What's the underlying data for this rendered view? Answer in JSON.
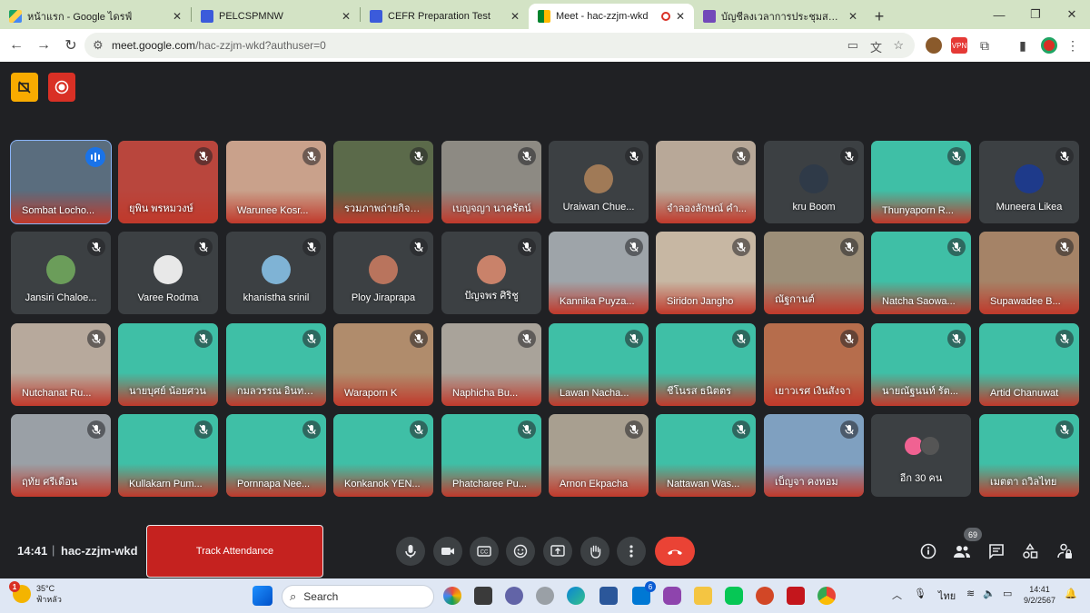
{
  "browser": {
    "tabs": [
      {
        "title": "หน้าแรก - Google ไดรฟ์",
        "active": false
      },
      {
        "title": "PELCSPMNW",
        "active": false
      },
      {
        "title": "CEFR Preparation Test",
        "active": false
      },
      {
        "title": "Meet - hac-zzjm-wkd",
        "active": true
      },
      {
        "title": "บัญชีลงเวลาการประชุมสอบ CEFR ปี",
        "active": false
      }
    ],
    "address_host": "meet.google.com",
    "address_path": "/hac-zzjm-wkd?authuser=0"
  },
  "participants": [
    {
      "name": "Sombat Locho...",
      "kind": "video",
      "speaking": true,
      "bg": "#5a6d7e"
    },
    {
      "name": "ยุพิน พรหมวงษ์",
      "kind": "video",
      "bg": "#b9463d"
    },
    {
      "name": "Warunee Kosr...",
      "kind": "video",
      "bg": "#c9a18b"
    },
    {
      "name": "รวมภาพถ่ายกิจก...",
      "kind": "video",
      "bg": "#5b6a4a"
    },
    {
      "name": "เบญจญา นาครัตน์",
      "kind": "video",
      "bg": "#8d8a83"
    },
    {
      "name": "Uraiwan Chue...",
      "kind": "avatar",
      "avatar": "#a07a57"
    },
    {
      "name": "จำลองลักษณ์ คำ...",
      "kind": "video",
      "bg": "#b8a898"
    },
    {
      "name": "kru Boom",
      "kind": "avatar",
      "avatar": "#2f3a48"
    },
    {
      "name": "Thunyaporn R...",
      "kind": "video",
      "bg": "#3fbfa6"
    },
    {
      "name": "Muneera Likea",
      "kind": "avatar",
      "avatar": "#1e3a8a"
    },
    {
      "name": "Jansiri Chaloe...",
      "kind": "avatar",
      "avatar": "#6b9d5a"
    },
    {
      "name": "Varee Rodma",
      "kind": "avatar",
      "avatar": "#e8e8e8"
    },
    {
      "name": "khanistha srinil",
      "kind": "avatar",
      "avatar": "#7fb3d5"
    },
    {
      "name": "Ploy Jiraprapa",
      "kind": "avatar",
      "avatar": "#b9745d"
    },
    {
      "name": "ปัญจพร ศิริชู",
      "kind": "avatar",
      "avatar": "#c9826a"
    },
    {
      "name": "Kannika Puyza...",
      "kind": "video",
      "bg": "#9ea4a9"
    },
    {
      "name": "Siridon Jangho",
      "kind": "video",
      "bg": "#c7b7a3"
    },
    {
      "name": "ณัฐกานต์",
      "kind": "video",
      "bg": "#9c8e78"
    },
    {
      "name": "Natcha Saowa...",
      "kind": "video",
      "bg": "#3fbfa6"
    },
    {
      "name": "Supawadee B...",
      "kind": "video",
      "bg": "#a58367"
    },
    {
      "name": "Nutchanat Ru...",
      "kind": "video",
      "bg": "#b7a99c"
    },
    {
      "name": "นายบุศย์ น้อยศวน",
      "kind": "video",
      "bg": "#3fbfa6"
    },
    {
      "name": "กมลวรรณ อินทร...",
      "kind": "video",
      "bg": "#3fbfa6"
    },
    {
      "name": "Waraporn K",
      "kind": "video",
      "bg": "#b08c6c"
    },
    {
      "name": "Naphicha Bu...",
      "kind": "video",
      "bg": "#a9a39a"
    },
    {
      "name": "Lawan Nacha...",
      "kind": "video",
      "bg": "#3fbfa6"
    },
    {
      "name": "ชีโนรส ธนิตตร",
      "kind": "video",
      "bg": "#3fbfa6"
    },
    {
      "name": "เยาวเรศ เงินสังจา",
      "kind": "video",
      "bg": "#b66d4c"
    },
    {
      "name": "นายณัฐนนท์ รัต...",
      "kind": "video",
      "bg": "#3fbfa6"
    },
    {
      "name": "Artid Chanuwat",
      "kind": "video",
      "bg": "#3fbfa6"
    },
    {
      "name": "ฤทัย ศรีเดือน",
      "kind": "video",
      "bg": "#9aa0a6"
    },
    {
      "name": "Kullakarn Pum...",
      "kind": "video",
      "bg": "#3fbfa6"
    },
    {
      "name": "Pornnapa Nee...",
      "kind": "video",
      "bg": "#3fbfa6"
    },
    {
      "name": "Konkanok YEN...",
      "kind": "video",
      "bg": "#3fbfa6"
    },
    {
      "name": "Phatcharee Pu...",
      "kind": "video",
      "bg": "#3fbfa6"
    },
    {
      "name": "Arnon Ekpacha",
      "kind": "video",
      "bg": "#a89f90"
    },
    {
      "name": "Nattawan Was...",
      "kind": "video",
      "bg": "#3fbfa6"
    },
    {
      "name": "เบ็ญจา คงหอม",
      "kind": "video",
      "bg": "#7fa0c0"
    },
    {
      "name": "อีก 30 คน",
      "kind": "others"
    },
    {
      "name": "เมตตา ถวิลไทย",
      "kind": "video",
      "bg": "#3fbfa6"
    }
  ],
  "meeting": {
    "time": "14:41",
    "code": "hac-zzjm-wkd",
    "track_attendance_label": "Track Attendance",
    "people_count": "69"
  },
  "taskbar": {
    "temperature": "35°C",
    "weather_text": "ฟ้าหลัว",
    "weather_badge": "1",
    "search_label": "Search",
    "language": "ไทย",
    "time": "14:41",
    "date": "9/2/2567",
    "mail_badge": "6"
  },
  "colors": {
    "meet_bg": "#202124",
    "tile_bg": "#3c4043",
    "end_call": "#ea4335",
    "track_button": "#c5221f",
    "tab_strip": "#d3e3c5"
  }
}
